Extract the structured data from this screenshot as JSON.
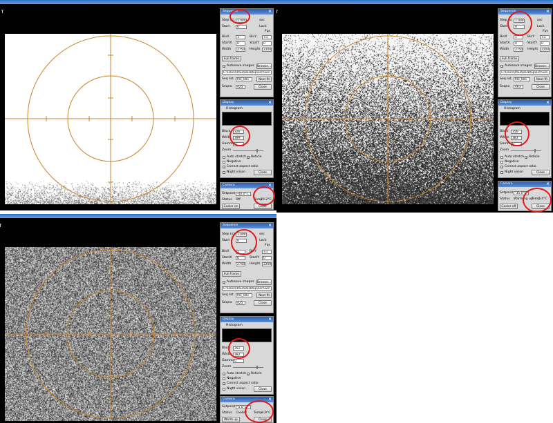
{
  "screens": [
    {
      "pin_glyph": "т",
      "sequence": {
        "title": "Sequence",
        "step_label": "Step (s)",
        "step_value": "1.000",
        "sec_label": "sec",
        "start_label": "Start",
        "start_value": "0",
        "lock_label": "Lock",
        "fps_label": "Fps",
        "binx_label": "BinX",
        "binx_value": "1",
        "biny_label": "BinY",
        "biny_value": "×1",
        "startx_label": "StartX",
        "startx_value": "0",
        "starty_label": "StartY",
        "starty_value": "0",
        "width_label": "Width",
        "width_value": "2750",
        "height_label": "Height",
        "height_value": "2200",
        "full_frame_label": "Full frame",
        "autosave_label": "Autosave images",
        "autosave_checked": true,
        "browse_label": "Browse...",
        "path_value": "C:\\Users\\Paul\\Desktop\\archive\\",
        "seqnum_label": "Seq list",
        "seqnum_value": "file_001",
        "next_fit_label": "Next fit",
        "seqno_label": "Seqno",
        "seqno_value": "425",
        "close_label": "Close"
      },
      "display": {
        "title": "Display",
        "histogram_label": "Histogram",
        "black_label": "Black",
        "black_value": "326",
        "white_label": "White",
        "white_value": "399",
        "gamma_label": "Gamma",
        "gamma_value": "0",
        "zoom_label": "Zoom",
        "autostretch_label": "Auto stretch",
        "autostretch_checked": false,
        "reticle_label": "Reticle",
        "reticle_checked": true,
        "negative_label": "Negative",
        "negative_checked": false,
        "correct_aspect_label": "Correct aspect ratio",
        "correct_aspect_checked": true,
        "night_vision_label": "Night vision",
        "night_vision_checked": false,
        "close_label": "Close"
      },
      "camera": {
        "title": "Camera",
        "setpoint_label": "Setpoint",
        "setpoint_value": "-40.0°C",
        "status_label": "Status",
        "status_value": "Off",
        "temp_label": "Temp",
        "temp_value": "20.2°C",
        "cooler_label": "Cooler on",
        "close_label": "Close"
      }
    },
    {
      "pin_glyph": "т",
      "sequence": {
        "title": "Sequence",
        "step_label": "Step (s)",
        "step_value": "1.000",
        "sec_label": "sec",
        "start_label": "Start",
        "start_value": "0",
        "lock_label": "Lock",
        "fps_label": "Fps",
        "binx_label": "BinX",
        "binx_value": "1",
        "biny_label": "BinY",
        "biny_value": "×1",
        "startx_label": "StartX",
        "startx_value": "0",
        "starty_label": "StartY",
        "starty_value": "0",
        "width_label": "Width",
        "width_value": "2750",
        "height_label": "Height",
        "height_value": "2200",
        "full_frame_label": "Full frame",
        "autosave_label": "Autosave images",
        "autosave_checked": true,
        "browse_label": "Browse...",
        "path_value": "C:\\Users\\Paul\\Desktop\\archive\\",
        "seqnum_label": "Seq list",
        "seqnum_value": "file_001",
        "next_fit_label": "Next fit",
        "seqno_label": "Seqno",
        "seqno_value": "463",
        "close_label": "Close"
      },
      "display": {
        "title": "Display",
        "histogram_label": "Histogram",
        "black_label": "Black",
        "black_value": "356",
        "white_label": "White",
        "white_value": "383",
        "gamma_label": "Gamma",
        "gamma_value": "0",
        "zoom_label": "Zoom",
        "autostretch_label": "Auto stretch",
        "autostretch_checked": false,
        "reticle_label": "Reticle",
        "reticle_checked": true,
        "negative_label": "Negative",
        "negative_checked": false,
        "correct_aspect_label": "Correct aspect ratio",
        "correct_aspect_checked": true,
        "night_vision_label": "Night vision",
        "night_vision_checked": false,
        "close_label": "Close"
      },
      "camera": {
        "title": "Camera",
        "setpoint_label": "Setpoint",
        "setpoint_value": "-35.0°C",
        "status_label": "Status",
        "status_value": "Warming up",
        "temp_label": "Temp",
        "temp_value": "5.4°C",
        "cooler_label": "Cooler off",
        "close_label": "Close"
      }
    },
    {
      "pin_glyph": "т",
      "sequence": {
        "title": "Sequence",
        "step_label": "Step (s)",
        "step_value": "1.000",
        "sec_label": "sec",
        "start_label": "Start",
        "start_value": "0",
        "lock_label": "Lock",
        "fps_label": "Fps",
        "binx_label": "BinX",
        "binx_value": "1",
        "biny_label": "BinY",
        "biny_value": "×1",
        "startx_label": "StartX",
        "startx_value": "0",
        "starty_label": "StartY",
        "starty_value": "0",
        "width_label": "Width",
        "width_value": "2750",
        "height_label": "Height",
        "height_value": "2200",
        "full_frame_label": "Full frame",
        "autosave_label": "Autosave images",
        "autosave_checked": true,
        "browse_label": "Browse...",
        "path_value": "C:\\Users\\Paul\\Desktop\\archive\\",
        "seqnum_label": "Seq list",
        "seqnum_value": "file_001",
        "next_fit_label": "Next fit",
        "seqno_label": "Seqno",
        "seqno_value": "425",
        "close_label": "Close"
      },
      "display": {
        "title": "Display",
        "histogram_label": "Histogram",
        "black_label": "Black",
        "black_value": "352",
        "white_label": "White",
        "white_value": "382",
        "gamma_label": "Gamma",
        "gamma_value": "0",
        "zoom_label": "Zoom",
        "autostretch_label": "Auto stretch",
        "autostretch_checked": true,
        "reticle_label": "Reticle",
        "reticle_checked": true,
        "negative_label": "Negative",
        "negative_checked": false,
        "correct_aspect_label": "Correct aspect ratio",
        "correct_aspect_checked": true,
        "night_vision_label": "Night vision",
        "night_vision_checked": false,
        "close_label": "Close"
      },
      "camera": {
        "title": "Camera",
        "setpoint_label": "Setpoint",
        "setpoint_value": "-5.0°C",
        "status_label": "Status",
        "status_value": "Cooled",
        "temp_label": "Temp",
        "temp_value": "-4.9°C",
        "cooler_label": "Warm up",
        "close_label": "Close"
      }
    }
  ],
  "colors": {
    "reticle": "#c8852a",
    "highlight_circle": "#e01818",
    "panel_bg": "#d8d8d8",
    "title_bar": "#2b5fae"
  }
}
